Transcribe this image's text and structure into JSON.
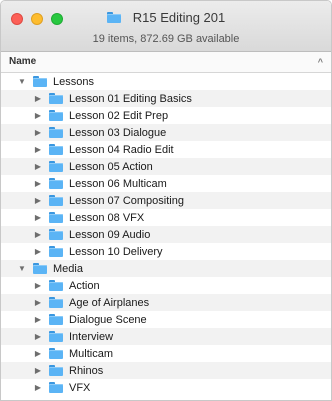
{
  "window": {
    "title": "R15 Editing 201",
    "status": "19 items, 872.69 GB available"
  },
  "columns": {
    "name": "Name",
    "sort_indicator": "^"
  },
  "groups": [
    {
      "name": "Lessons",
      "expanded": true,
      "items": [
        "Lesson 01 Editing Basics",
        "Lesson 02 Edit Prep",
        "Lesson 03 Dialogue",
        "Lesson 04 Radio Edit",
        "Lesson 05 Action",
        "Lesson 06 Multicam",
        "Lesson 07 Compositing",
        "Lesson 08 VFX",
        "Lesson 09 Audio",
        "Lesson 10 Delivery"
      ]
    },
    {
      "name": "Media",
      "expanded": true,
      "items": [
        "Action",
        "Age of Airplanes",
        "Dialogue Scene",
        "Interview",
        "Multicam",
        "Rhinos",
        "VFX"
      ]
    }
  ]
}
